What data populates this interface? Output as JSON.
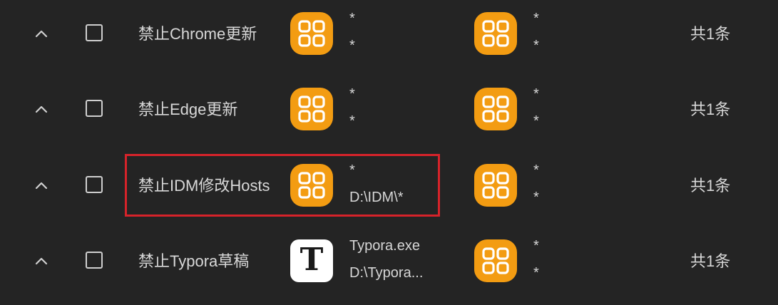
{
  "rules": [
    {
      "name": "禁止Chrome更新",
      "process_icon": "apps-grid-icon",
      "process_line1": "*",
      "process_line2": "*",
      "target_icon": "apps-grid-icon",
      "target_line1": "*",
      "target_line2": "*",
      "count": "共1条"
    },
    {
      "name": "禁止Edge更新",
      "process_icon": "apps-grid-icon",
      "process_line1": "*",
      "process_line2": "*",
      "target_icon": "apps-grid-icon",
      "target_line1": "*",
      "target_line2": "*",
      "count": "共1条"
    },
    {
      "name": "禁止IDM修改Hosts",
      "process_icon": "apps-grid-icon",
      "process_line1": "*",
      "process_line2": "D:\\IDM\\*",
      "target_icon": "apps-grid-icon",
      "target_line1": "*",
      "target_line2": "*",
      "count": "共1条"
    },
    {
      "name": "禁止Typora草稿",
      "process_icon": "typora-icon",
      "process_icon_letter": "T",
      "process_line1": "Typora.exe",
      "process_line2": "D:\\Typora...",
      "target_icon": "apps-grid-icon",
      "target_line1": "*",
      "target_line2": "*",
      "count": "共1条"
    }
  ],
  "colors": {
    "background": "#242424",
    "text": "#d6d6d6",
    "app_icon_orange": "#f39c12",
    "highlight_red": "#d6232a"
  }
}
